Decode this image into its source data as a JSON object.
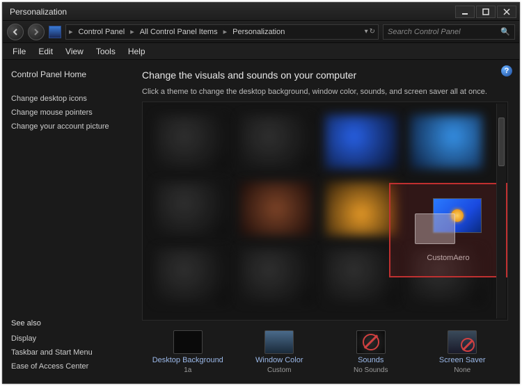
{
  "window": {
    "title": "Personalization"
  },
  "breadcrumb": {
    "items": [
      "Control Panel",
      "All Control Panel Items",
      "Personalization"
    ]
  },
  "search": {
    "placeholder": "Search Control Panel"
  },
  "menus": [
    "File",
    "Edit",
    "View",
    "Tools",
    "Help"
  ],
  "sidebar": {
    "home": "Control Panel Home",
    "links": [
      "Change desktop icons",
      "Change mouse pointers",
      "Change your account picture"
    ],
    "seealso_heading": "See also",
    "seealso": [
      "Display",
      "Taskbar and Start Menu",
      "Ease of Access Center"
    ]
  },
  "main": {
    "heading": "Change the visuals and sounds on your computer",
    "sub": "Click a theme to change the desktop background, window color, sounds, and screen saver all at once.",
    "selected_theme": "CustomAero"
  },
  "bottom": {
    "desktop_bg": {
      "label": "Desktop Background",
      "value": "1a"
    },
    "window_color": {
      "label": "Window Color",
      "value": "Custom"
    },
    "sounds": {
      "label": "Sounds",
      "value": "No Sounds"
    },
    "screensaver": {
      "label": "Screen Saver",
      "value": "None"
    }
  }
}
